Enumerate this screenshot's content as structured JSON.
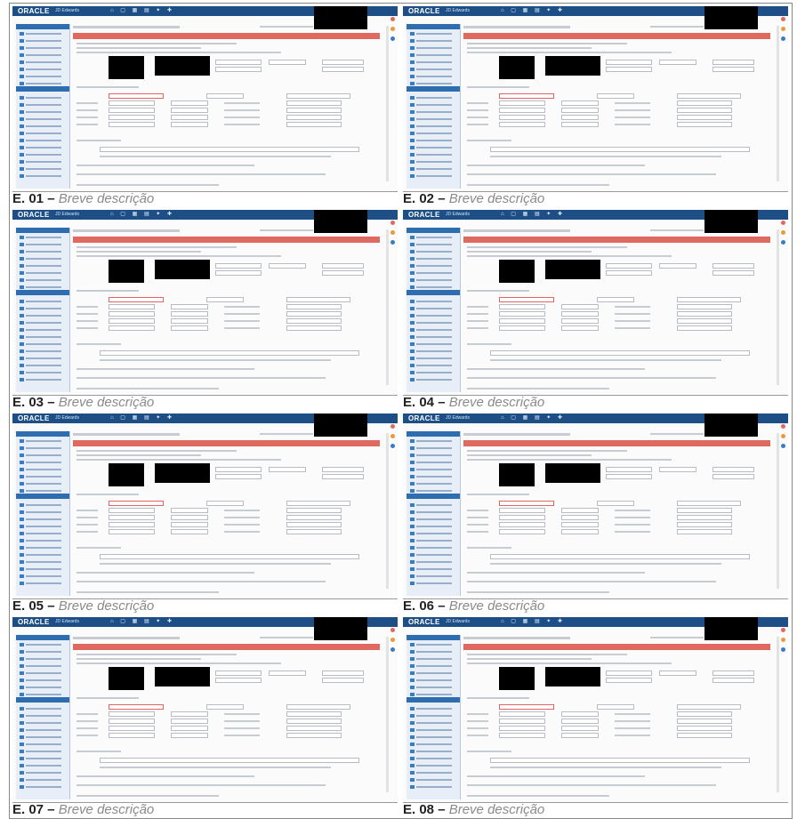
{
  "app": {
    "logo_text": "ORACLE",
    "logo_sub": "JD Edwards",
    "brand_color": "#1d4f86",
    "alert_color": "#e0695f"
  },
  "screens": [
    {
      "id": "E. 01",
      "desc": "Breve descrição"
    },
    {
      "id": "E. 02",
      "desc": "Breve descrição"
    },
    {
      "id": "E. 03",
      "desc": "Breve descrição"
    },
    {
      "id": "E. 04",
      "desc": "Breve descrição"
    },
    {
      "id": "E. 05",
      "desc": "Breve descrição"
    },
    {
      "id": "E. 06",
      "desc": "Breve descrição"
    },
    {
      "id": "E. 07",
      "desc": "Breve descrição"
    },
    {
      "id": "E. 08",
      "desc": "Breve descrição"
    }
  ],
  "caption_separator": " – "
}
